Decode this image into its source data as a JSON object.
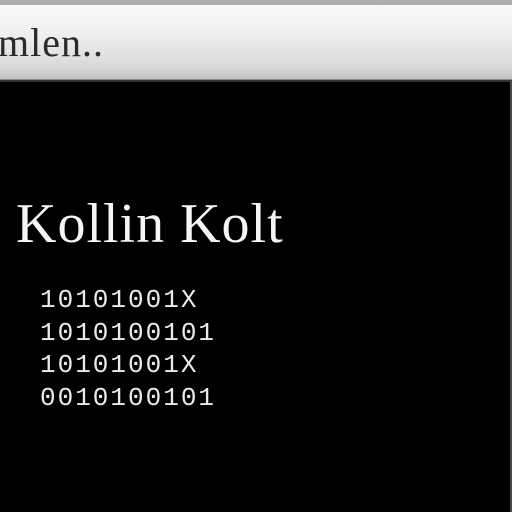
{
  "titlebar": {
    "title": "mlen.."
  },
  "content": {
    "heading": "Kollin  Kolt",
    "binary_lines": [
      "10101001X",
      "1010100101",
      "10101001X",
      "0010100101"
    ]
  }
}
